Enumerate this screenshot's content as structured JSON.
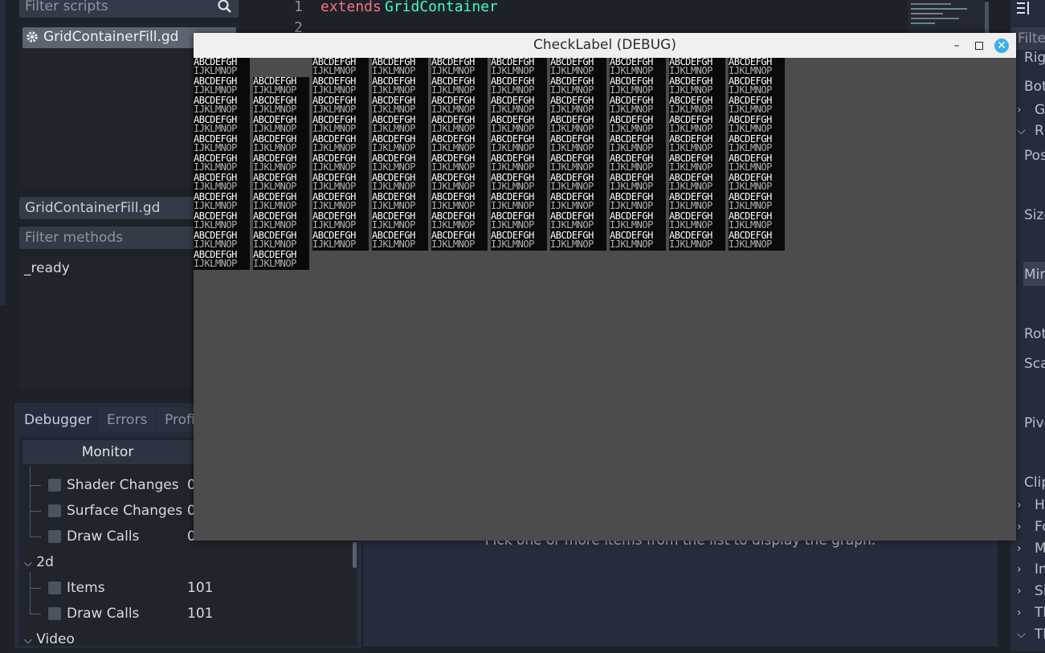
{
  "scripts_panel": {
    "filter_placeholder": "Filter scripts",
    "items": [
      {
        "label": "GridContainerFill.gd"
      }
    ]
  },
  "methods_panel": {
    "current_script": "GridContainerFill.gd",
    "filter_placeholder": "Filter methods",
    "methods": [
      "_ready"
    ]
  },
  "editor": {
    "lines": [
      {
        "num": "1",
        "keyword": "extends",
        "text": "GridContainer"
      },
      {
        "num": "2",
        "keyword": "",
        "text": ""
      }
    ]
  },
  "debugger": {
    "tabs": [
      "Debugger",
      "Errors",
      "Profi"
    ],
    "monitor_header": "Monitor",
    "rows": [
      {
        "label": "Shader Changes",
        "value": "0"
      },
      {
        "label": "Surface Changes",
        "value": "0"
      },
      {
        "label": "Draw Calls",
        "value": "0"
      }
    ],
    "group_2d": "2d",
    "rows_2d": [
      {
        "label": "Items",
        "value": "101"
      },
      {
        "label": "Draw Calls",
        "value": "101"
      }
    ],
    "group_video": "Video",
    "graph_message": "Pick one or more items from the list to display the graph."
  },
  "inspector": {
    "filter_placeholder": "Filter",
    "labels": [
      "Rig",
      "Bot",
      "G",
      "R",
      "Pos",
      "Size",
      "Min",
      "Rot",
      "Sca",
      "Pive",
      "Clip",
      "H",
      "Fo",
      "M",
      "In",
      "Si",
      "Th",
      "Th"
    ]
  },
  "debug_window": {
    "title": "CheckLabel (DEBUG)",
    "cell_line1": "ABCDEFGH",
    "cell_line2": "IJKLMNOP",
    "columns": 10,
    "total_cells": 101,
    "skipped_cells": 1,
    "colors": {
      "titlebar": "#efefef",
      "close": "#3daee9",
      "background": "#4c4c4c"
    }
  }
}
